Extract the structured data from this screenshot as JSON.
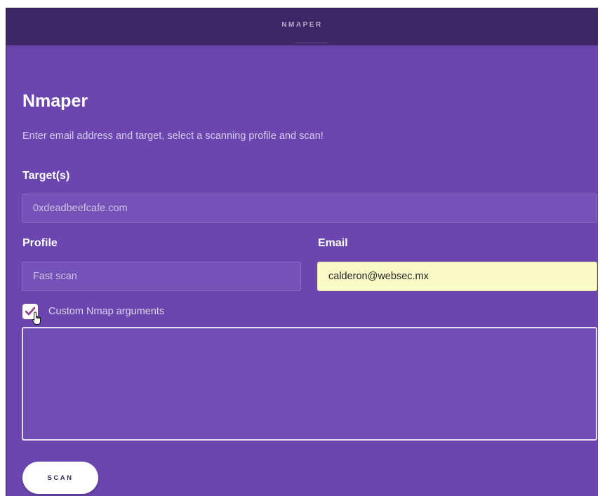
{
  "topbar": {
    "brand": "NMAPER"
  },
  "main": {
    "title": "Nmaper",
    "subtitle": "Enter email address and target, select a scanning profile and scan!"
  },
  "form": {
    "target_label": "Target(s)",
    "target_placeholder": "0xdeadbeefcafe.com",
    "target_value": "",
    "profile_label": "Profile",
    "profile_placeholder": "Fast scan",
    "profile_value": "",
    "email_label": "Email",
    "email_value": "calderon@websec.mx",
    "custom_args_label": "Custom Nmap arguments",
    "custom_args_checked": true,
    "custom_args_value": "",
    "scan_label": "SCAN"
  },
  "colors": {
    "background": "#6a46ae",
    "topbar": "#3d2766",
    "autofill": "#fafbc6",
    "checkmark": "#8e3d8e"
  }
}
